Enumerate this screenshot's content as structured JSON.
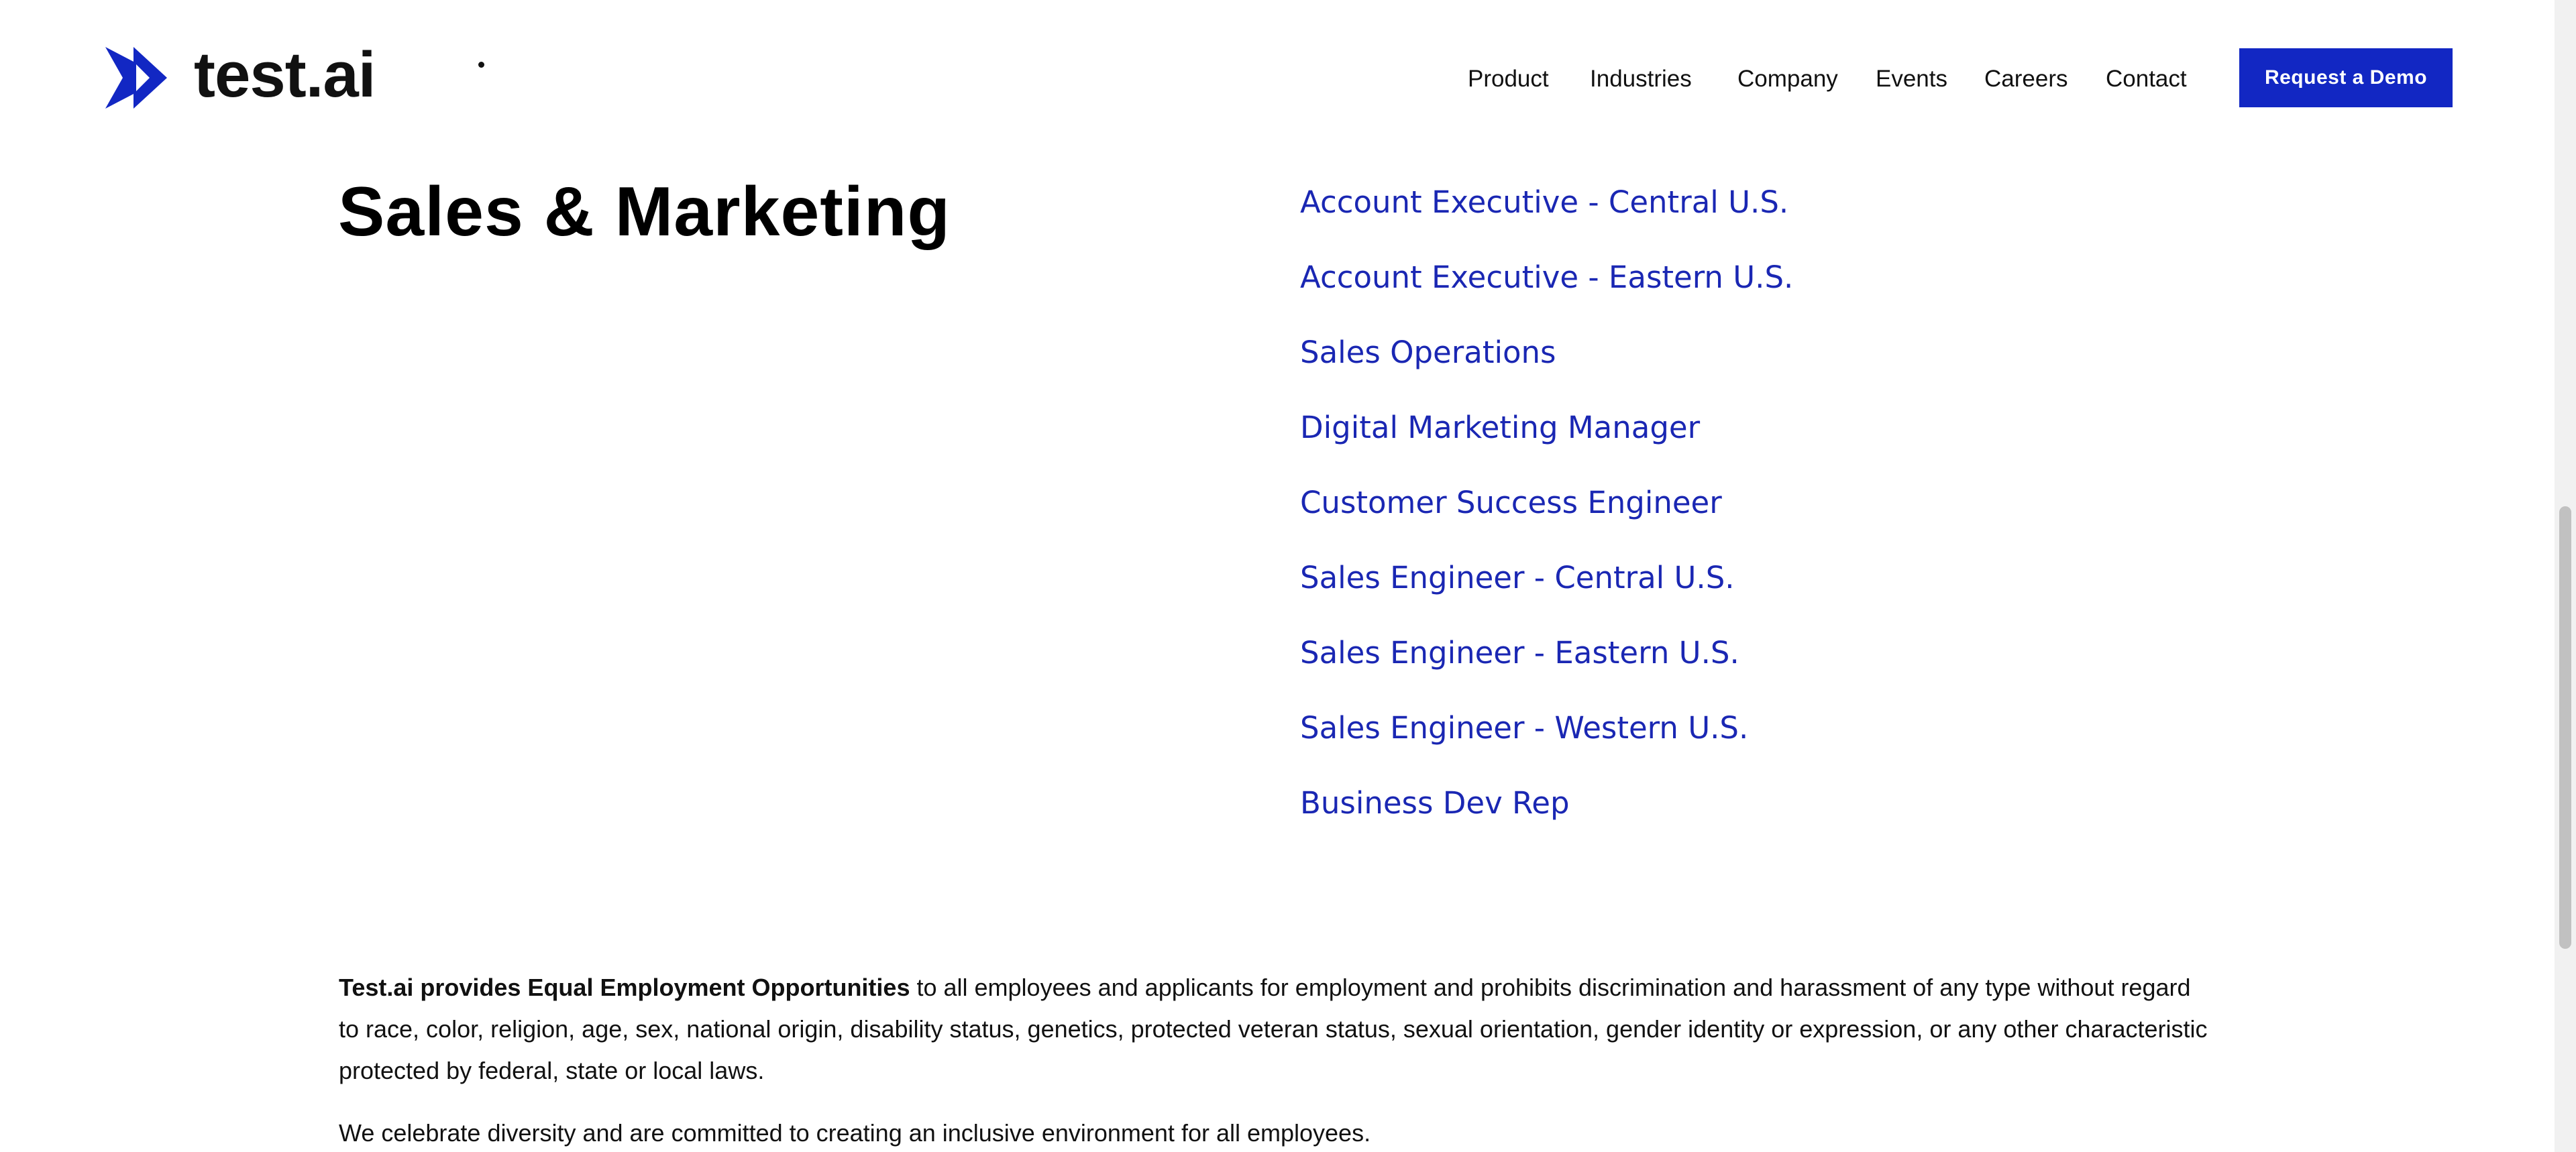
{
  "header": {
    "logo_text": "test.ai",
    "nav": [
      "Product",
      "Industries",
      "Company",
      "Events",
      "Careers",
      "Contact"
    ],
    "demo_button": "Request a Demo"
  },
  "section": {
    "title": "Sales & Marketing",
    "jobs": [
      "Account Executive - Central U.S.",
      "Account Executive - Eastern U.S.",
      "Sales Operations",
      "Digital Marketing Manager",
      "Customer Success Engineer",
      "Sales Engineer - Central U.S.",
      "Sales Engineer - Eastern U.S.",
      "Sales Engineer - Western U.S.",
      "Business Dev Rep"
    ]
  },
  "eeo": {
    "lead": "Test.ai provides Equal Employment Opportunities",
    "body": " to all employees and applicants for employment and prohibits discrimination and harassment of any type without regard to race, color, religion, age, sex, national origin, disability status, genetics, protected veteran status, sexual orientation, gender identity or expression, or any other characteristic protected by federal, state or local laws.",
    "diversity": "We celebrate diversity and are committed to creating an inclusive environment for all employees."
  },
  "colors": {
    "brand_blue": "#1227c3",
    "link_blue": "#1a27b3",
    "text": "#111111"
  }
}
